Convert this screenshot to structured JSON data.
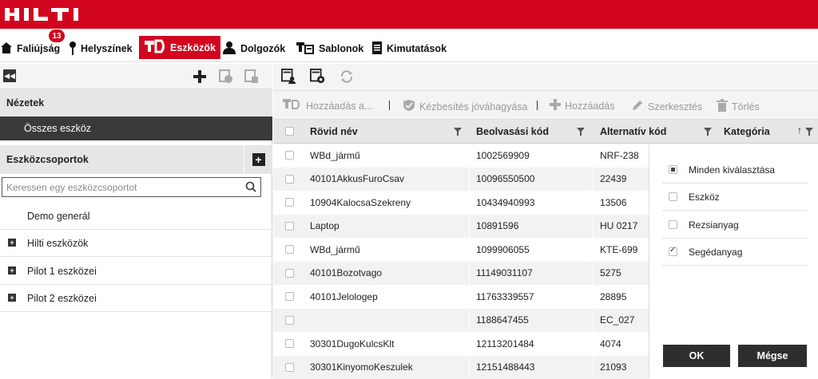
{
  "brand": {
    "logo_text": "HILTI",
    "color": "#d2051e"
  },
  "nav": {
    "badge": "13",
    "items": [
      {
        "label": "Faliújság",
        "icon": "home-icon"
      },
      {
        "label": "Helyszínek",
        "icon": "location-icon"
      },
      {
        "label": "Eszközök",
        "icon": "tools-icon",
        "active": true
      },
      {
        "label": "Dolgozók",
        "icon": "person-icon"
      },
      {
        "label": "Sablonok",
        "icon": "template-icon"
      },
      {
        "label": "Kimutatások",
        "icon": "report-icon"
      }
    ]
  },
  "left": {
    "views_header": "Nézetek",
    "all_tools": "Összes eszköz",
    "groups_header": "Eszközcsoportok",
    "search_placeholder": "Keressen egy eszközcsoportot",
    "groups": [
      {
        "label": "Demo generál",
        "expandable": false
      },
      {
        "label": "Hilti eszközök",
        "expandable": true
      },
      {
        "label": "Pilot 1 eszközei",
        "expandable": true
      },
      {
        "label": "Pilot 2 eszközei",
        "expandable": true
      }
    ]
  },
  "actions": {
    "add": "Hozzáadás a...",
    "approve": "Kézbesítés jóváhagyása",
    "add2": "Hozzáadás",
    "edit": "Szerkesztés",
    "delete": "Törlés"
  },
  "table": {
    "columns": [
      "Rövid név",
      "Beolvasási kód",
      "Alternatív kód",
      "Kategória"
    ],
    "rows": [
      {
        "name": "WBd_jármű",
        "scan": "1002569909",
        "alt": "NRF-238"
      },
      {
        "name": "40101AkkusFuroCsav",
        "scan": "10096550500",
        "alt": "22439"
      },
      {
        "name": "10904KalocsaSzekreny",
        "scan": "10434940993",
        "alt": "13506"
      },
      {
        "name": "Laptop",
        "scan": "10891596",
        "alt": "HU 0217"
      },
      {
        "name": "WBd_jármű",
        "scan": "1099906055",
        "alt": "KTE-699"
      },
      {
        "name": "40101Bozotvago",
        "scan": "11149031107",
        "alt": "5275"
      },
      {
        "name": "40101Jelologep",
        "scan": "11763339557",
        "alt": "28895"
      },
      {
        "name": "",
        "scan": "1188647455",
        "alt": "EC_027"
      },
      {
        "name": "30301DugoKulcsKlt",
        "scan": "12113201484",
        "alt": "4074"
      },
      {
        "name": "30301KinyomoKeszulek",
        "scan": "12151488443",
        "alt": "21093"
      }
    ]
  },
  "filter": {
    "options": [
      {
        "label": "Minden kiválasztása",
        "state": "partial"
      },
      {
        "label": "Eszköz",
        "state": "unchecked"
      },
      {
        "label": "Rezsianyag",
        "state": "unchecked"
      },
      {
        "label": "Segédanyag",
        "state": "checked"
      }
    ],
    "ok": "OK",
    "cancel": "Mégse"
  }
}
